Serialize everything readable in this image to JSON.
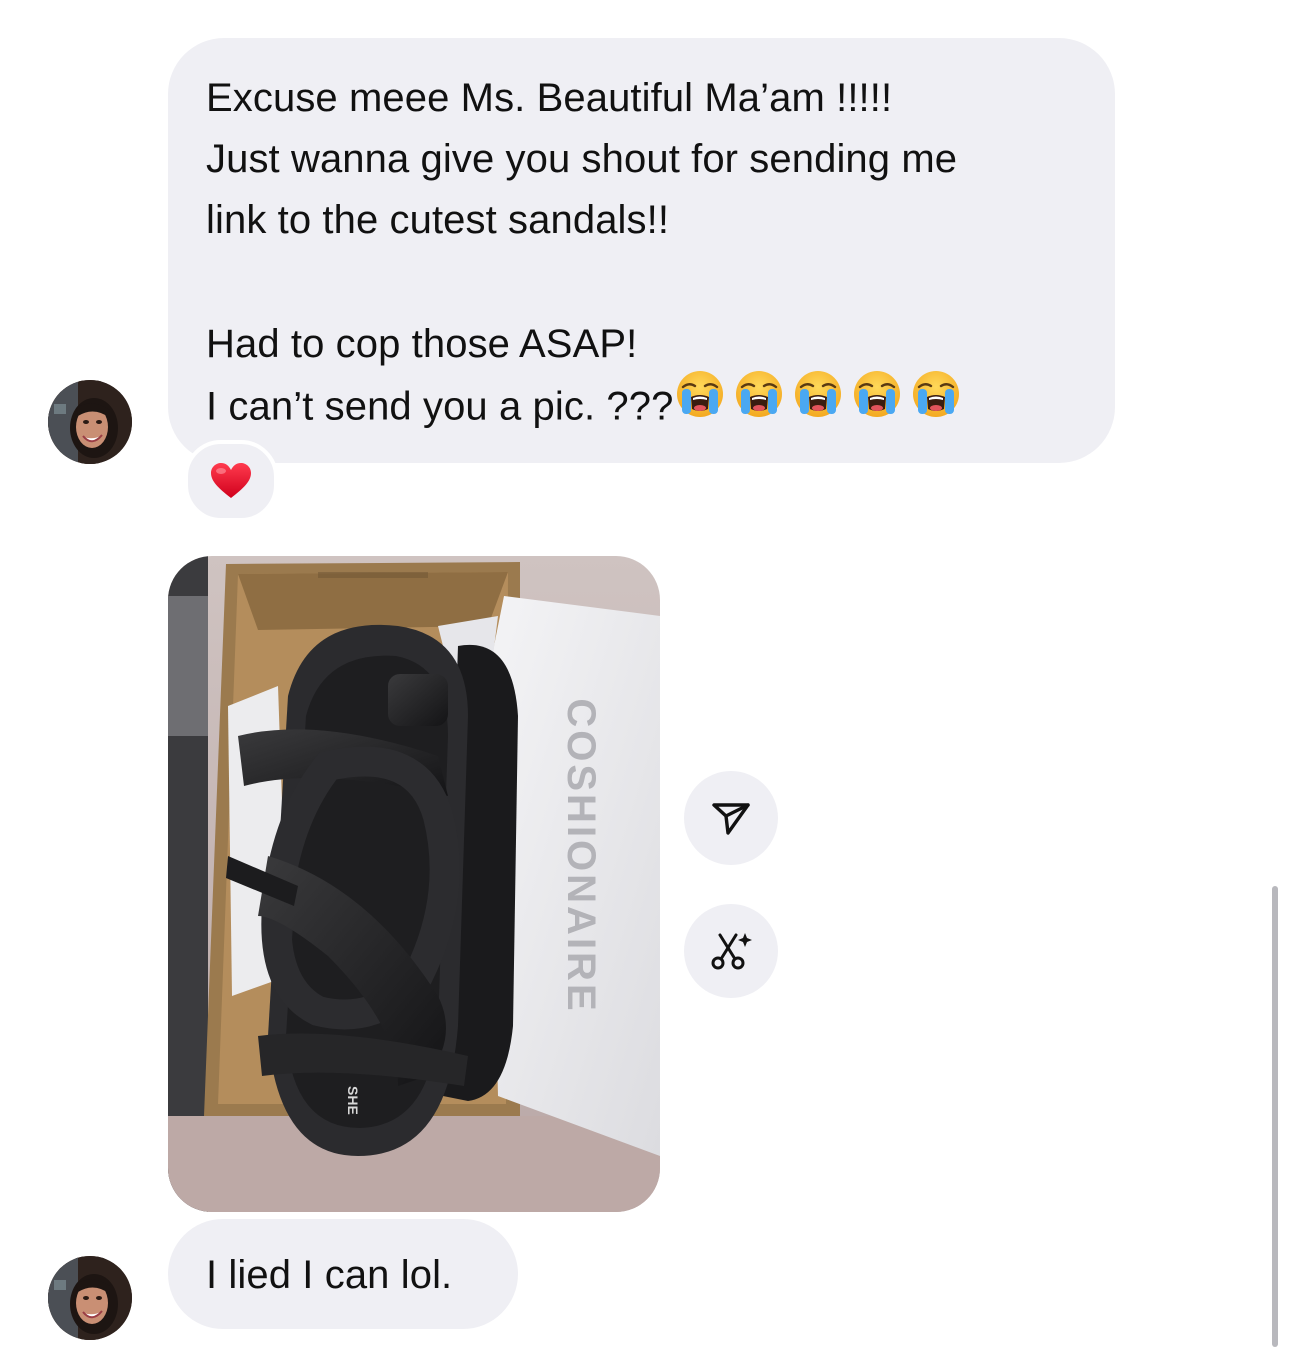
{
  "messages": {
    "first": {
      "lines": [
        "Excuse meee Ms. Beautiful Ma’am !!!!!",
        "Just wanna give you shout for sending me",
        "link  to the cutest sandals!!",
        "Had to cop those ASAP!",
        "I can’t send you a pic. ???"
      ],
      "trailing_emoji": "crying-face-emoji",
      "trailing_emoji_count": 5,
      "reaction": "heart-reaction"
    },
    "photo": {
      "box_print": "COSHIONAIRE",
      "sole_print": "SHE"
    },
    "second": {
      "text": "I lied I can lol."
    }
  },
  "actions": {
    "share_icon": "share-icon",
    "edit_icon": "scissors-sparkle-icon"
  },
  "colors": {
    "bubble": "#efeff4",
    "reaction_heart": "#e0102a",
    "scrollbar": "#b8b8bd"
  }
}
